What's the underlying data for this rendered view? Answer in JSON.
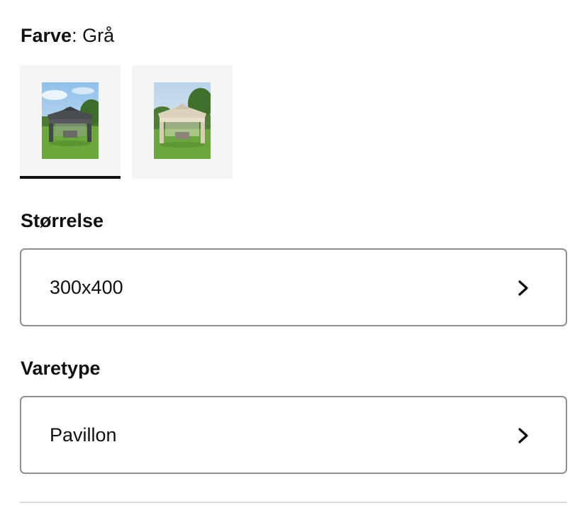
{
  "color": {
    "label": "Farve",
    "separator": ":",
    "value": "Grå",
    "options": [
      {
        "name": "gray-gazebo-thumbnail",
        "selected": true
      },
      {
        "name": "beige-gazebo-thumbnail",
        "selected": false
      }
    ]
  },
  "size": {
    "label": "Størrelse",
    "value": "300x400",
    "icon": "chevron-right-icon"
  },
  "product_type": {
    "label": "Varetype",
    "value": "Pavillon",
    "icon": "chevron-right-icon"
  },
  "colors": {
    "selected_indicator": "#111111",
    "swatch_background": "#f5f5f5",
    "select_border": "#8f8f8f",
    "divider": "#dcdcdc"
  }
}
